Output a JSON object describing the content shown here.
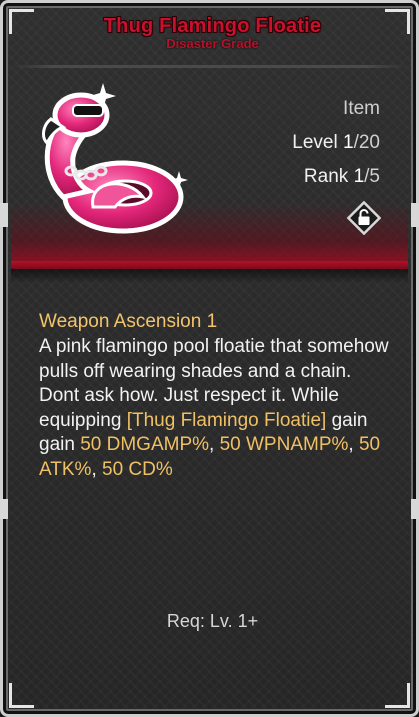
{
  "item": {
    "name": "Thug Flamingo Floatie",
    "grade": "Disaster Grade",
    "type": "Item",
    "level_label": "Level ",
    "level_current": "1",
    "level_max": "/20",
    "rank_label": "Rank ",
    "rank_current": "1",
    "rank_max": "/5",
    "icon": "flamingo-floatie-icon",
    "lock_icon": "unlock-icon"
  },
  "description": {
    "title": "Weapon Ascension 1",
    "body_1": "A pink flamingo pool floatie that somehow pulls off wearing shades and a chain. Dont ask how. Just respect it. While equipping ",
    "item_ref": "[Thug Flamingo Floatie]",
    "body_2": " gain gain ",
    "stat_1": "50 DMGAMP%",
    "sep_1": ", ",
    "stat_2": "50 WPNAMP%",
    "sep_2": ", ",
    "stat_3": "50 ATK%",
    "sep_3": ", ",
    "stat_4": "50 CD%"
  },
  "requirement": "Req: Lv. 1+",
  "colors": {
    "name": "#c8112c",
    "highlight": "#f0c064",
    "panel_red": "#b3122a"
  }
}
